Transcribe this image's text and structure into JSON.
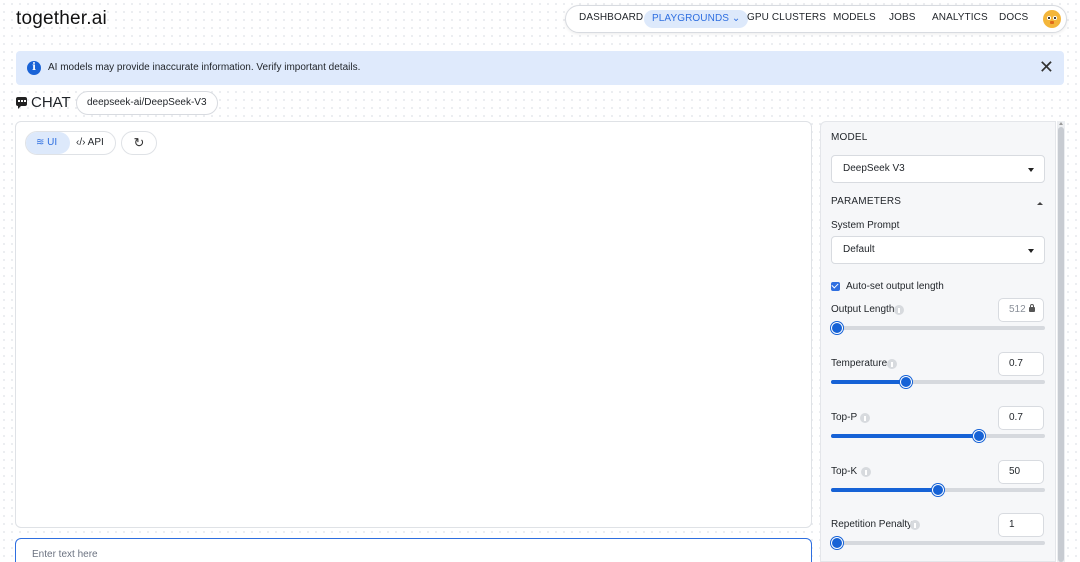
{
  "header": {
    "logo": "together.ai",
    "nav": [
      {
        "label": "DASHBOARD"
      },
      {
        "label": "PLAYGROUNDS ⌄",
        "active": true
      },
      {
        "label": "GPU CLUSTERS"
      },
      {
        "label": "MODELS"
      },
      {
        "label": "JOBS"
      },
      {
        "label": "ANALYTICS"
      },
      {
        "label": "DOCS"
      }
    ]
  },
  "alert": {
    "text": "AI models may provide inaccurate information. Verify important details.",
    "close": "✕"
  },
  "chat": {
    "title": "CHAT",
    "model_chip": "deepseek-ai/DeepSeek-V3",
    "toggle_ui": "≋ UI",
    "toggle_api": "‹/› API",
    "reset": "↻",
    "input_placeholder": "Enter text here"
  },
  "settings": {
    "model_section": "MODEL",
    "model_value": "DeepSeek V3",
    "parameters_section": "PARAMETERS",
    "system_prompt_label": "System Prompt",
    "system_prompt_value": "Default",
    "auto_output_label": "Auto-set output length",
    "auto_output_checked": true,
    "params": [
      {
        "label": "Output Length",
        "value": "512",
        "locked": true,
        "fraction": 0.03
      },
      {
        "label": "Temperature",
        "value": "0.7",
        "fraction": 0.35
      },
      {
        "label": "Top-P",
        "value": "0.7",
        "fraction": 0.69
      },
      {
        "label": "Top-K",
        "value": "50",
        "fraction": 0.5
      },
      {
        "label": "Repetition Penalty",
        "value": "1",
        "fraction": 0.03
      }
    ]
  },
  "colors": {
    "accent": "#1662d6",
    "alert_bg": "#dfeafc",
    "active_nav_bg": "#dde9fb"
  }
}
